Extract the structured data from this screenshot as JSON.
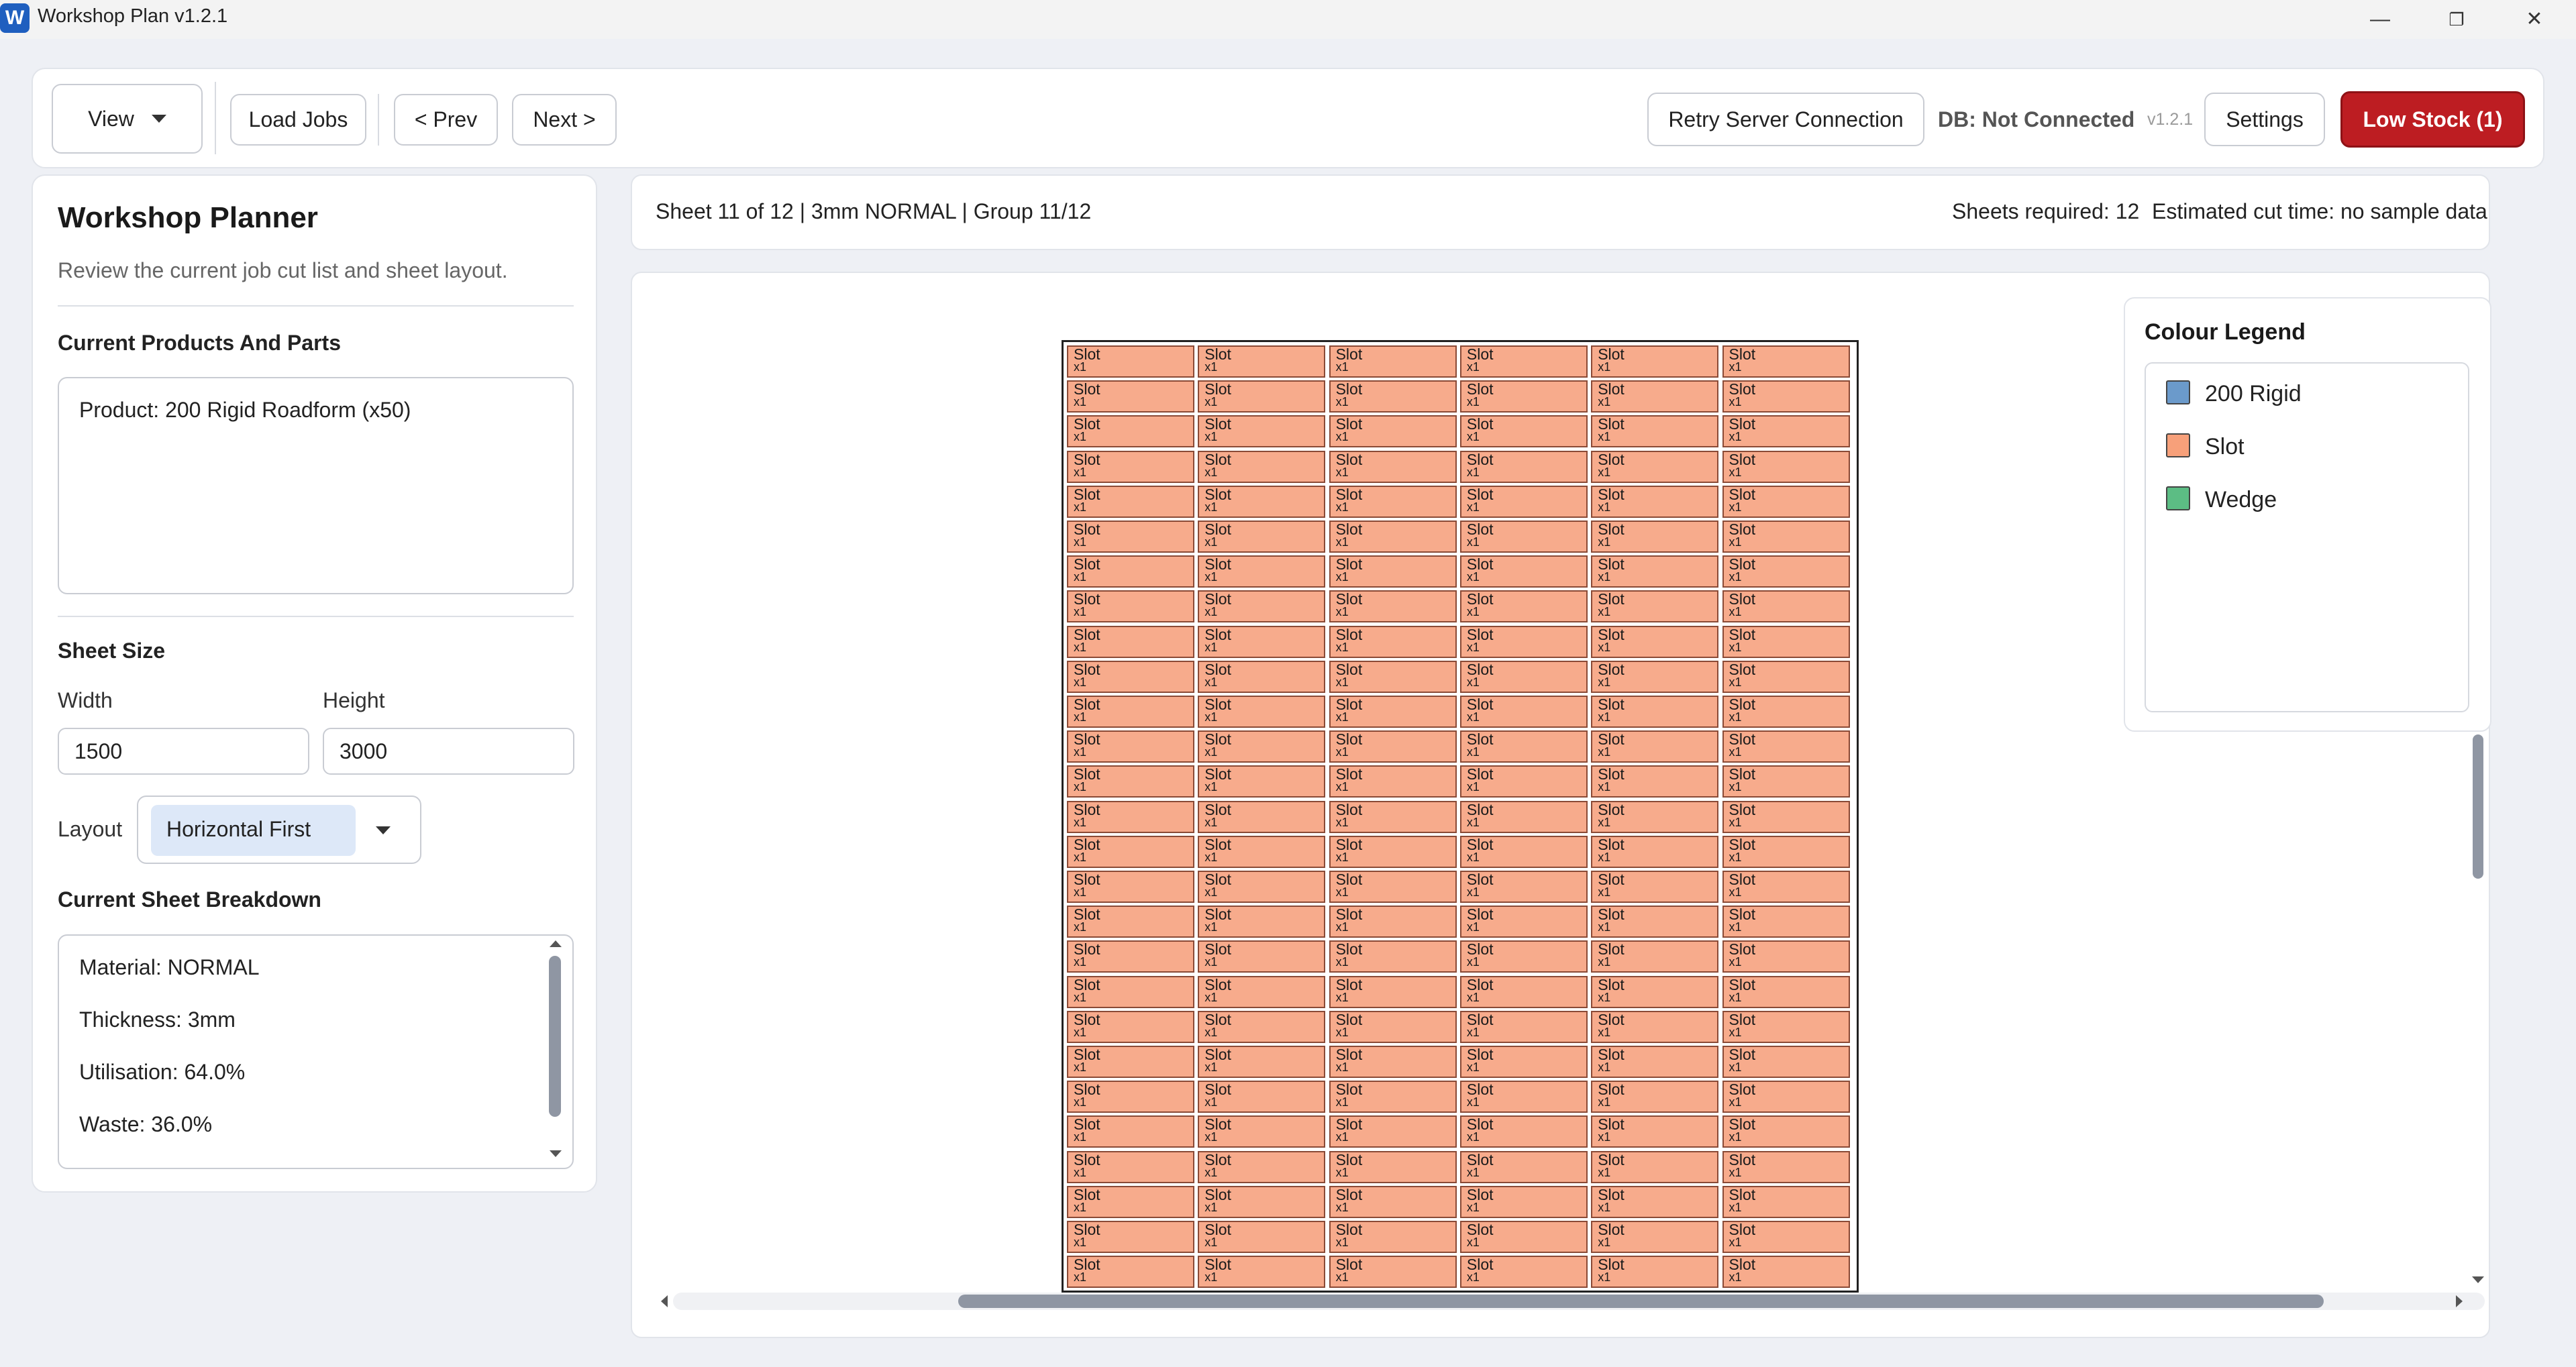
{
  "window": {
    "app_icon_letter": "W",
    "title": "Workshop Plan v1.2.1",
    "minimize_glyph": "—",
    "maximize_glyph": "❐",
    "close_glyph": "✕"
  },
  "toolbar": {
    "view_label": "View",
    "load_jobs_label": "Load Jobs",
    "prev_label": "< Prev",
    "next_label": "Next >",
    "retry_label": "Retry Server Connection",
    "db_status": "DB: Not Connected",
    "version": "v1.2.1",
    "settings_label": "Settings",
    "low_stock_label": "Low Stock (1)"
  },
  "left_panel": {
    "title": "Workshop Planner",
    "subtitle": "Review the current job cut list and sheet layout.",
    "products_heading": "Current Products And Parts",
    "products_text": "Product: 200 Rigid Roadform (x50)",
    "sheet_size_heading": "Sheet Size",
    "width_label": "Width",
    "height_label": "Height",
    "width_value": "1500",
    "height_value": "3000",
    "layout_label": "Layout",
    "layout_value": "Horizontal First",
    "breakdown_heading": "Current Sheet Breakdown",
    "breakdown": {
      "material": "Material: NORMAL",
      "thickness": "Thickness: 3mm",
      "utilisation": "Utilisation: 64.0%",
      "waste": "Waste: 36.0%"
    }
  },
  "info_bar": {
    "sheet_info": "Sheet 11 of 12 | 3mm NORMAL | Group 11/12",
    "sheets_required": "Sheets required: 12",
    "cut_time": "Estimated cut time: no sample data"
  },
  "sheet": {
    "part_label": "Slot",
    "part_qty": "x1",
    "columns": 6,
    "rows": 27,
    "part_color": "#f7ab8c"
  },
  "legend": {
    "title": "Colour Legend",
    "items": [
      {
        "label": "200 Rigid",
        "color": "#6b9acb"
      },
      {
        "label": "Slot",
        "color": "#f7a07a"
      },
      {
        "label": "Wedge",
        "color": "#5cbd84"
      }
    ]
  },
  "colors": {
    "accent_danger": "#bd1d22",
    "app_icon": "#1f5fbf",
    "background": "#eef0f5"
  }
}
